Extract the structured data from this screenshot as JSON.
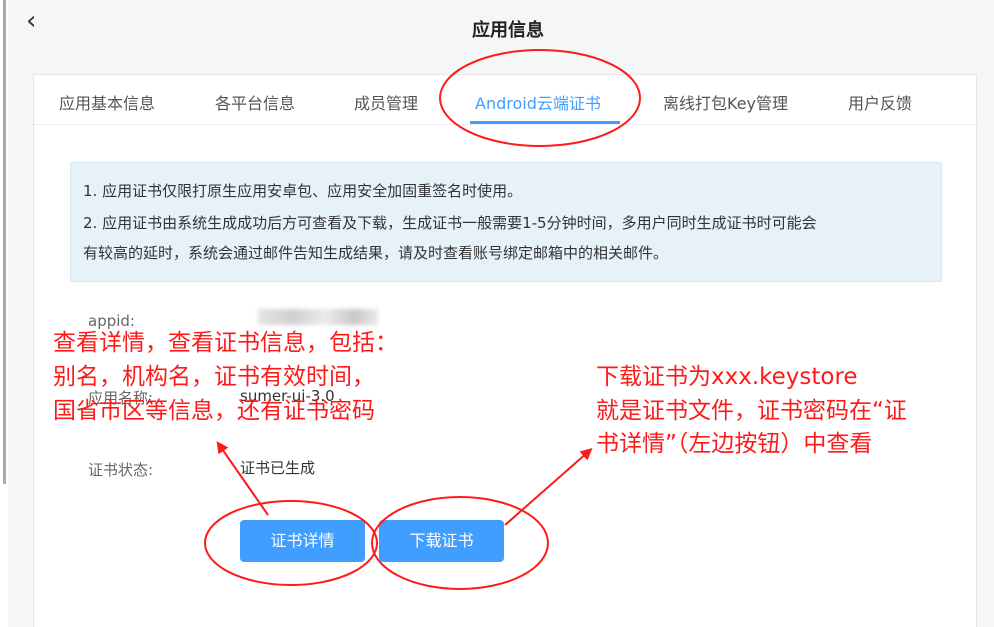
{
  "header": {
    "back_icon": "chevron-left-icon",
    "title": "应用信息"
  },
  "tabs": [
    {
      "label": "应用基本信息"
    },
    {
      "label": "各平台信息"
    },
    {
      "label": "成员管理"
    },
    {
      "label": "Android云端证书",
      "active": true
    },
    {
      "label": "离线打包Key管理"
    },
    {
      "label": "用户反馈"
    }
  ],
  "notice": {
    "line1": "1. 应用证书仅限打原生应用安卓包、应用安全加固重签名时使用。",
    "line2": "2. 应用证书由系统生成成功后方可查看及下载，生成证书一般需要1-5分钟时间，多用户同时生成证书时可能会",
    "line3": "有较高的延时，系统会通过邮件告知生成结果，请及时查看账号绑定邮箱中的相关邮件。"
  },
  "fields": {
    "appid_label": "appid:",
    "app_name_label": "应用名称:",
    "app_name_value": "sumer-ui-3.0",
    "status_label": "证书状态:",
    "status_value": "证书已生成"
  },
  "buttons": {
    "details": "证书详情",
    "download": "下载证书"
  },
  "annotations": {
    "left_1": "查看详情，查看证书信息，包括：",
    "left_2": "别名，机构名，证书有效时间，",
    "left_3": "国省市区等信息，还有证书密码",
    "right_1": "下载证书为xxx.keystore",
    "right_2": "就是证书文件，证书密码在“证",
    "right_3": "书详情”（左边按钮）中查看"
  },
  "colors": {
    "accent": "#409eff",
    "annotation": "#ff1a1a",
    "notice_bg": "#e6f1f8"
  }
}
